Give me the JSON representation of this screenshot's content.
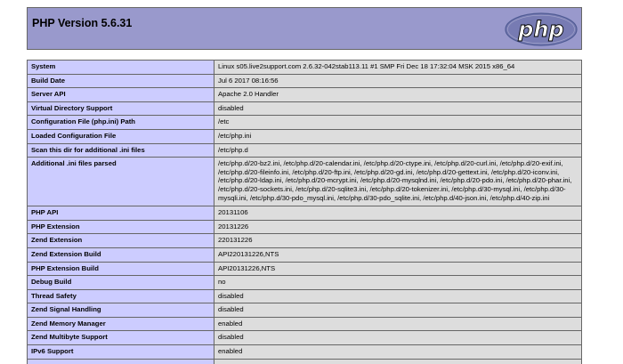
{
  "header": {
    "title": "PHP Version 5.6.31",
    "logo_text": "php"
  },
  "rows": [
    {
      "key": "System",
      "value": "Linux s05.live2support.com 2.6.32-042stab113.11 #1 SMP Fri Dec 18 17:32:04 MSK 2015 x86_64"
    },
    {
      "key": "Build Date",
      "value": "Jul 6 2017 08:16:56"
    },
    {
      "key": "Server API",
      "value": "Apache 2.0 Handler"
    },
    {
      "key": "Virtual Directory Support",
      "value": "disabled"
    },
    {
      "key": "Configuration File (php.ini) Path",
      "value": "/etc"
    },
    {
      "key": "Loaded Configuration File",
      "value": "/etc/php.ini"
    },
    {
      "key": "Scan this dir for additional .ini files",
      "value": "/etc/php.d"
    },
    {
      "key": "Additional .ini files parsed",
      "value": "/etc/php.d/20-bz2.ini, /etc/php.d/20-calendar.ini, /etc/php.d/20-ctype.ini, /etc/php.d/20-curl.ini, /etc/php.d/20-exif.ini, /etc/php.d/20-fileinfo.ini, /etc/php.d/20-ftp.ini, /etc/php.d/20-gd.ini, /etc/php.d/20-gettext.ini, /etc/php.d/20-iconv.ini, /etc/php.d/20-ldap.ini, /etc/php.d/20-mcrypt.ini, /etc/php.d/20-mysqlnd.ini, /etc/php.d/20-pdo.ini, /etc/php.d/20-phar.ini, /etc/php.d/20-sockets.ini, /etc/php.d/20-sqlite3.ini, /etc/php.d/20-tokenizer.ini, /etc/php.d/30-mysql.ini, /etc/php.d/30-mysqli.ini, /etc/php.d/30-pdo_mysql.ini, /etc/php.d/30-pdo_sqlite.ini, /etc/php.d/40-json.ini, /etc/php.d/40-zip.ini"
    },
    {
      "key": "PHP API",
      "value": "20131106"
    },
    {
      "key": "PHP Extension",
      "value": "20131226"
    },
    {
      "key": "Zend Extension",
      "value": "220131226"
    },
    {
      "key": "Zend Extension Build",
      "value": "API220131226,NTS"
    },
    {
      "key": "PHP Extension Build",
      "value": "API20131226,NTS"
    },
    {
      "key": "Debug Build",
      "value": "no"
    },
    {
      "key": "Thread Safety",
      "value": "disabled"
    },
    {
      "key": "Zend Signal Handling",
      "value": "disabled"
    },
    {
      "key": "Zend Memory Manager",
      "value": "enabled"
    },
    {
      "key": "Zend Multibyte Support",
      "value": "disabled"
    },
    {
      "key": "IPv6 Support",
      "value": "enabled"
    },
    {
      "key": "",
      "value": ""
    }
  ],
  "colors": {
    "header_bg": "#9999cc",
    "key_bg": "#ccccff",
    "value_bg": "#dddddd",
    "border": "#666666",
    "logo_bg": "#777bb3"
  }
}
